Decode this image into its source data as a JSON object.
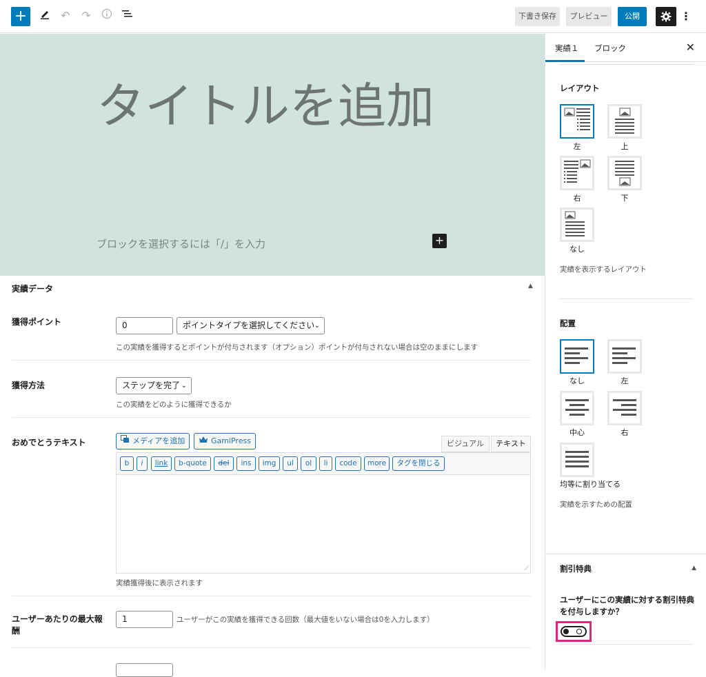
{
  "toolbar": {
    "add_icon": "plus-icon",
    "draft_label": "下書き保存",
    "preview_label": "プレビュー",
    "publish_label": "公開",
    "settings_icon": "gear-icon",
    "more_icon": "vertical-dots-icon"
  },
  "editor": {
    "title_placeholder": "タイトルを追加",
    "block_placeholder": "ブロックを選択するには「/」を入力",
    "cover_color": "#d1e3de"
  },
  "meta": {
    "heading": "実績データ",
    "points": {
      "label": "獲得ポイント",
      "value": "0",
      "type_select": "ポイントタイプを選択してください",
      "help": "この実績を獲得するとポイントが付与されます（オプション）ポイントが付与されない場合は空のままにします"
    },
    "method": {
      "label": "獲得方法",
      "select": "ステップを完了",
      "help": "この実績をどのように獲得できるか"
    },
    "congrats": {
      "label": "おめでとうテキスト",
      "media_button": "メディアを追加",
      "gamipress_button": "GamiPress",
      "tab_visual": "ビジュアル",
      "tab_text": "テキスト",
      "quicktags": [
        "b",
        "i",
        "link",
        "b-quote",
        "del",
        "ins",
        "img",
        "ul",
        "ol",
        "li",
        "code",
        "more",
        "タグを閉じる"
      ],
      "help": "実績獲得後に表示されます"
    },
    "max": {
      "label": "ユーザーあたりの最大報酬",
      "value": "1",
      "help": "ユーザーがこの実績を獲得できる回数（最大値をいない場合は0を入力します）"
    }
  },
  "sidebar": {
    "tab_doc": "実績１",
    "tab_block": "ブロック",
    "layout": {
      "heading": "レイアウト",
      "options": [
        "左",
        "上",
        "右",
        "下",
        "なし"
      ],
      "help": "実績を表示するレイアウト"
    },
    "align": {
      "heading": "配置",
      "options": [
        "なし",
        "左",
        "中心",
        "右",
        "均等に割り当てる"
      ],
      "help": "実績を示すための配置"
    },
    "discount": {
      "heading": "割引特典",
      "question": "ユーザーにこの実績に対する割引特典を付与しますか？",
      "highlight_color": "#e0267a"
    }
  },
  "colors": {
    "accent": "#007cba"
  }
}
